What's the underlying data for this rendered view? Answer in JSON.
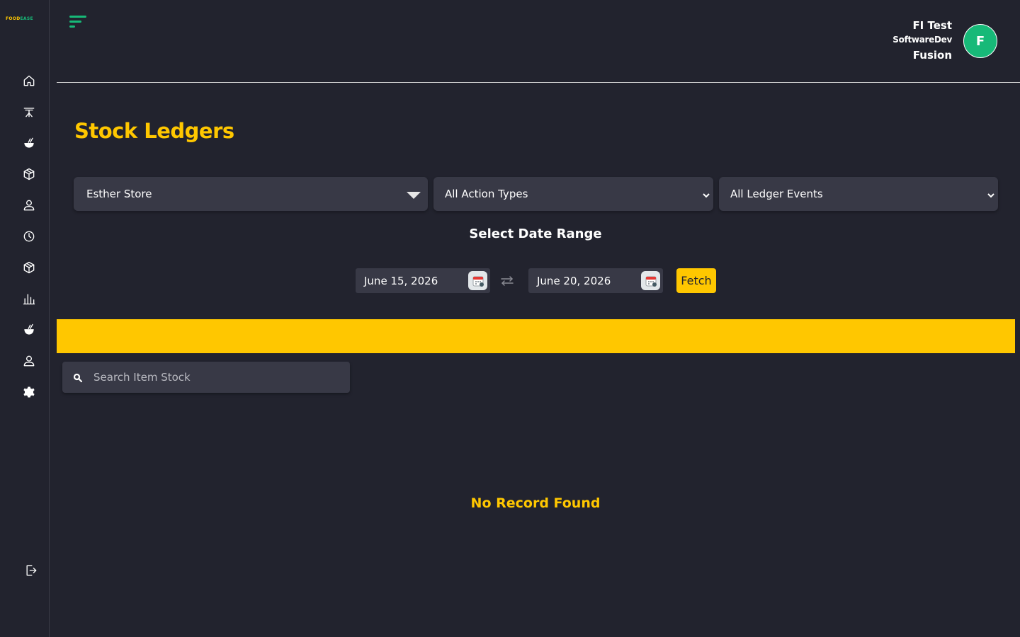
{
  "brand": {
    "logo_part1": "FOOD",
    "logo_part2": "EASE",
    "accent": "#ffc700",
    "brand_green": "#17b978"
  },
  "sidebar": {
    "items": [
      {
        "icon": "home-icon"
      },
      {
        "icon": "dining-table-icon"
      },
      {
        "icon": "food-bowl-icon"
      },
      {
        "icon": "package-icon"
      },
      {
        "icon": "user-icon"
      },
      {
        "icon": "clock-icon"
      },
      {
        "icon": "package-icon"
      },
      {
        "icon": "bar-chart-icon"
      },
      {
        "icon": "food-bowl-icon"
      },
      {
        "icon": "user-icon"
      },
      {
        "icon": "settings-icon"
      }
    ],
    "logout_icon": "logout-icon"
  },
  "header": {
    "user_name": "FI Test",
    "user_org": "SoftwareDev",
    "user_sub": "Fusion",
    "avatar_initial": "F"
  },
  "main": {
    "title": "Stock Ledgers",
    "store_select": "Esther Store",
    "action_types_select": "All Action Types",
    "ledger_events_select": "All Ledger Events",
    "date_range_label": "Select Date Range",
    "start_date": "June 15, 2026",
    "end_date": "June 20, 2026",
    "fetch_label": "Fetch",
    "search_placeholder": "Search Item Stock",
    "empty_message": "No Record Found"
  }
}
